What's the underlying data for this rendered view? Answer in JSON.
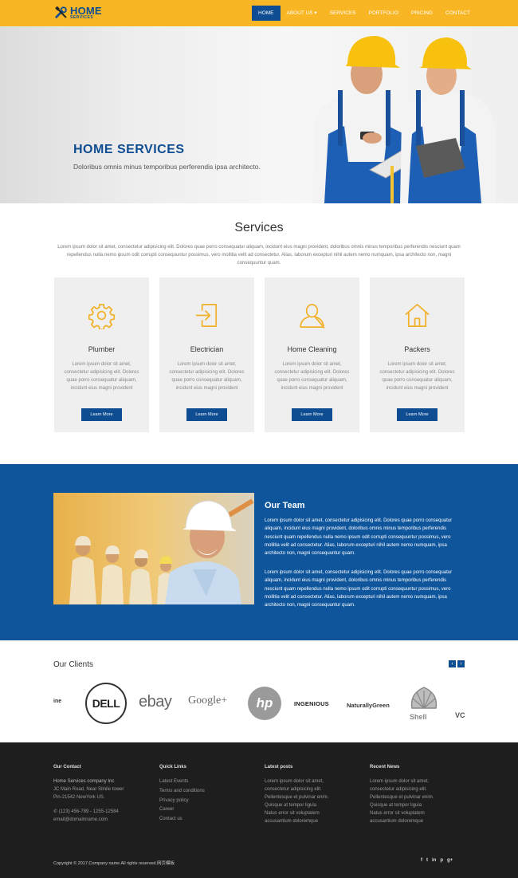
{
  "brand": {
    "title": "HOME",
    "subtitle": "SERVICES"
  },
  "nav": [
    {
      "label": "HOME",
      "active": true
    },
    {
      "label": "ABOUT US ▾"
    },
    {
      "label": "SERVICES"
    },
    {
      "label": "PORTFOLIO"
    },
    {
      "label": "PRICING"
    },
    {
      "label": "CONTACT"
    }
  ],
  "hero": {
    "title": "HOME SERVICES",
    "subtitle": "Doloribus omnis minus temporibus perferendis ipsa architecto."
  },
  "services": {
    "title": "Services",
    "intro": "Lorem ipsum dolor sit amet, consectetur adipisicing elit. Dolores quae porro consequatur aliquam, incidunt eius magni provident, doloribus omnis minus temporibus perferendis nesciunt quam repellendus nulla nemo ipsum odit corrupti consequuntur possimus, vero mollitia velit ad consectetur. Alias, laborum excepturi nihil autem nemo numquam, ipsa architecto non, magni consequuntur quam.",
    "cards": [
      {
        "icon": "gear-icon",
        "title": "Plumber",
        "text": "Lorem ipsum dolor sit amet, consectetur adipisicing elit. Dolores quae porro consequatur aliquam, incidunt eius magni provident",
        "button": "Learn More"
      },
      {
        "icon": "sign-in-icon",
        "title": "Electrician",
        "text": "Lorem ipsum dolor sit amet, consectetur adipisicing elit. Dolores quae porro consequatur aliquam, incidunt eius magni provident",
        "button": "Learn More"
      },
      {
        "icon": "user-icon",
        "title": "Home Cleaning",
        "text": "Lorem ipsum dolor sit amet, consectetur adipisicing elit. Dolores quae porro consequatur aliquam, incidunt eius magni provident",
        "button": "Learn More"
      },
      {
        "icon": "home-icon",
        "title": "Packers",
        "text": "Lorem ipsum dolor sit amet, consectetur adipisicing elit. Dolores quae porro consequatur aliquam, incidunt eius magni provident",
        "button": "Learn More"
      }
    ]
  },
  "team": {
    "title": "Our Team",
    "paragraphs": [
      "Lorem ipsum dolor sit amet, consectetur adipisicing elit. Dolores quae porro consequatur aliquam, incidunt eius magni provident, doloribus omnis minus temporibus perferendis nesciunt quam repellendus nulla nemo ipsum odit corrupti consequuntur possimus, vero mollitia velit ad consectetur. Alias, laborum excepturi nihil autem nemo numquam, ipsa architecto non, magni consequuntur quam.",
      "Lorem ipsum dolor sit amet, consectetur adipisicing elit. Dolores quae porro consequatur aliquam, incidunt eius magni provident, doloribus omnis minus temporibus perferendis nesciunt quam repellendus nulla nemo ipsum odit corrupti consequuntur possimus, vero mollitia velit ad consectetur. Alias, laborum excepturi nihil autem nemo numquam, ipsa architecto non, magni consequuntur quam."
    ]
  },
  "clients": {
    "title": "Our Clients",
    "prev": "‹",
    "next": "›",
    "logos": [
      "ine",
      "DELL",
      "ebay",
      "Google+",
      "hp",
      "INGENIOUS",
      "NaturallyGreen",
      "Shell",
      "VC"
    ]
  },
  "footer": {
    "contact": {
      "heading": "Our Contact",
      "company": "Home Services company Inc",
      "address1": "JC Main Road, Near Silnile tower",
      "address2": "Pin-21542 NewYork US.",
      "phone": "(123) 456-789 - 1255-12584",
      "email": "email@domainname.com"
    },
    "quick_links": {
      "heading": "Quick Links",
      "items": [
        "Latest Events",
        "Terms and conditions",
        "Privacy policy",
        "Career",
        "Contact us"
      ]
    },
    "latest_posts": {
      "heading": "Latest posts",
      "items": [
        "Lorem ipsum dolor sit amet,",
        "consectetur adipisicing elit.",
        "Pellentesque et pulvinar enim.",
        "Quisque at tempor ligula",
        "Natus error sit voluptatem",
        "accusantium doloremque"
      ]
    },
    "recent_news": {
      "heading": "Recent News",
      "items": [
        "Lorem ipsum dolor sit amet,",
        "consectetur adipisicing elit.",
        "Pellentesque et pulvinar enim.",
        "Quisque at tempor ligula",
        "Natus error sit voluptatem",
        "accusantium doloremque"
      ]
    },
    "copyright": "Copyright © 2017.Company name All rights reserved.网页模板",
    "social": [
      "f",
      "t",
      "in",
      "p",
      "g+"
    ]
  },
  "colors": {
    "accent": "#f9b624",
    "brand": "#0e4d92",
    "team_bg": "#0e559c",
    "footer_bg": "#1e1e1e"
  }
}
